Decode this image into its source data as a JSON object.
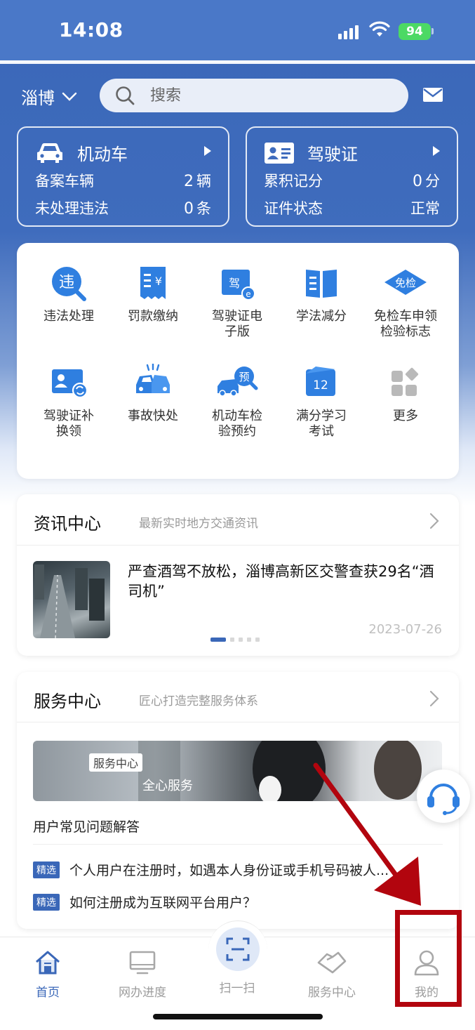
{
  "status_bar": {
    "time": "14:08",
    "battery": "94"
  },
  "header": {
    "city": "淄博",
    "search_placeholder": "搜索"
  },
  "vehicle_card": {
    "title": "机动车",
    "rows": [
      {
        "label": "备案车辆",
        "value": "2",
        "unit": "辆"
      },
      {
        "label": "未处理违法",
        "value": "0",
        "unit": "条"
      }
    ]
  },
  "license_card": {
    "title": "驾驶证",
    "rows": [
      {
        "label": "累积记分",
        "value": "0",
        "unit": "分"
      },
      {
        "label": "证件状态",
        "value": "正常",
        "unit": ""
      }
    ]
  },
  "services": [
    {
      "label": "违法处理",
      "icon": "violation-icon"
    },
    {
      "label": "罚款缴纳",
      "icon": "fine-receipt-icon"
    },
    {
      "label": "驾驶证电子版",
      "icon": "e-license-icon"
    },
    {
      "label": "学法减分",
      "icon": "book-icon"
    },
    {
      "label": "免检车申领检验标志",
      "icon": "inspection-exempt-icon"
    },
    {
      "label": "驾驶证补换领",
      "icon": "license-renew-icon"
    },
    {
      "label": "事故快处",
      "icon": "accident-icon"
    },
    {
      "label": "机动车检验预约",
      "icon": "inspection-booking-icon"
    },
    {
      "label": "满分学习考试",
      "icon": "calendar-12-icon"
    },
    {
      "label": "更多",
      "icon": "more-grid-icon"
    }
  ],
  "news": {
    "title": "资讯中心",
    "subtitle": "最新实时地方交通资讯",
    "headline": "严查酒驾不放松，淄博高新区交警查获29名“酒司机”",
    "date": "2023-07-26"
  },
  "service_center": {
    "title": "服务中心",
    "subtitle": "匠心打造完整服务体系",
    "banner_tag": "服务中心",
    "banner_text": "全心服务",
    "faq_title": "用户常见问题解答",
    "faqs": [
      {
        "tag": "精选",
        "text": "个人用户在注册时，如遇本人身份证或手机号码被人..."
      },
      {
        "tag": "精选",
        "text": "如何注册成为互联网平台用户？"
      }
    ]
  },
  "tabbar": [
    {
      "label": "首页",
      "icon": "home-icon",
      "active": true
    },
    {
      "label": "网办进度",
      "icon": "monitor-icon",
      "active": false
    },
    {
      "label": "扫一扫",
      "icon": "scan-icon",
      "active": false
    },
    {
      "label": "服务中心",
      "icon": "handshake-icon",
      "active": false
    },
    {
      "label": "我的",
      "icon": "user-icon",
      "active": false
    }
  ],
  "colors": {
    "primary": "#3a67b8",
    "accent_blue": "#2f7fe0",
    "annotation_red": "#b2050e"
  }
}
